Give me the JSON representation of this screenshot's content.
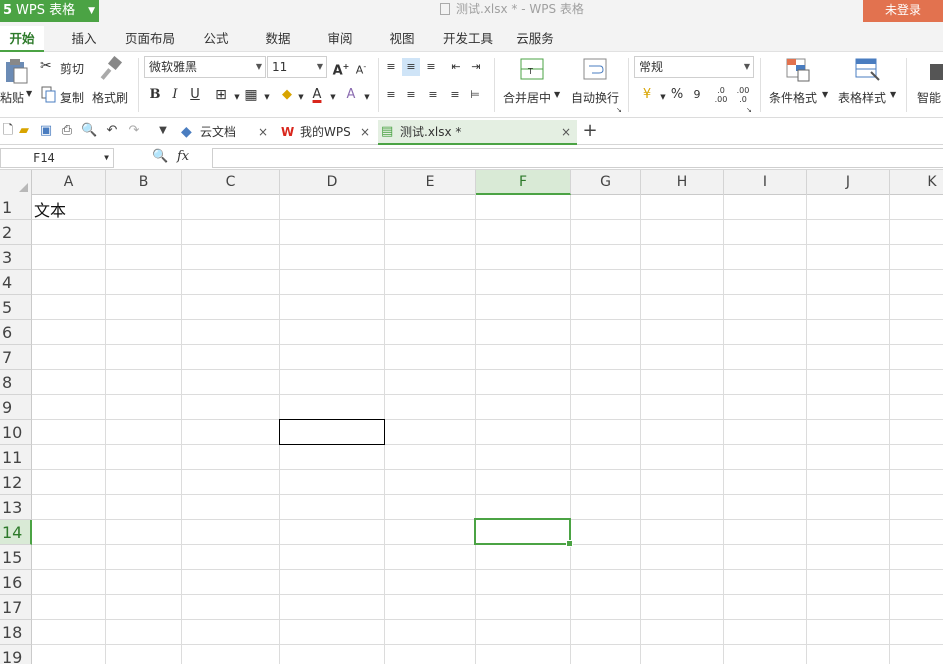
{
  "titlebar": {
    "app_button": "WPS 表格",
    "app_logo": "5",
    "document_title": "测试.xlsx * - WPS 表格",
    "login_button": "未登录",
    "login_color": "#e2724f",
    "brand_color": "#4ba344"
  },
  "menu_tabs": [
    "开始",
    "插入",
    "页面布局",
    "公式",
    "数据",
    "审阅",
    "视图",
    "开发工具",
    "云服务"
  ],
  "ribbon": {
    "paste": "粘贴",
    "cut": "剪切",
    "copy": "复制",
    "format_painter": "格式刷",
    "font_name": "微软雅黑",
    "font_size": "11",
    "merge_center": "合并居中",
    "wrap_text": "自动换行",
    "number_format": "常规",
    "percent": "%",
    "comma": "9",
    "conditional_format": "条件格式",
    "table_style": "表格样式",
    "smart": "智能"
  },
  "doc_tabs": [
    {
      "label": "云文档",
      "icon": "cloud-box-icon"
    },
    {
      "label": "我的WPS",
      "icon": "wps-logo-icon"
    },
    {
      "label": "测试.xlsx *",
      "icon": "spreadsheet-file-icon"
    }
  ],
  "formula_bar": {
    "name_box": "F14",
    "fx": "fx",
    "formula": ""
  },
  "sheet": {
    "columns": [
      "A",
      "B",
      "C",
      "D",
      "E",
      "F",
      "G",
      "H",
      "I",
      "J",
      "K"
    ],
    "rows": [
      "1",
      "2",
      "3",
      "4",
      "5",
      "6",
      "7",
      "8",
      "9",
      "10",
      "11",
      "12",
      "13",
      "14",
      "15",
      "16",
      "17",
      "18",
      "19"
    ],
    "active_column": "F",
    "active_row": "14",
    "cells": {
      "A1": "文本"
    },
    "bordered_cell": "D10",
    "selected_cell": "F14"
  }
}
